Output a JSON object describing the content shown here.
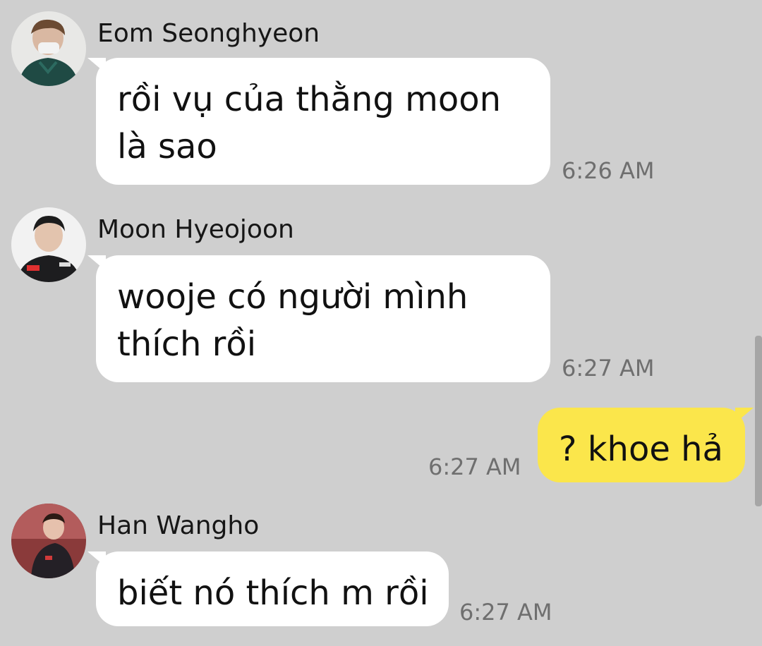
{
  "messages": [
    {
      "sender": "Eom Seonghyeon",
      "lines": [
        "rồi vụ của thằng moon",
        "là sao"
      ],
      "time": "6:26 AM",
      "avatar": "avatar-eom-seonghyeon"
    },
    {
      "sender": "Moon Hyeojoon",
      "lines": [
        "wooje có người mình",
        "thích rồi"
      ],
      "time": "6:27 AM",
      "avatar": "avatar-moon-hyeojoon"
    },
    {
      "sender": "",
      "lines": [
        "? khoe hả"
      ],
      "time": "6:27 AM",
      "outgoing": true
    },
    {
      "sender": "Han Wangho",
      "lines": [
        "biết nó thích m rồi"
      ],
      "time": "6:27 AM",
      "avatar": "avatar-han-wangho"
    }
  ],
  "colors": {
    "background": "#cfcfcf",
    "incoming_bubble": "#ffffff",
    "outgoing_bubble": "#fbe64b",
    "timestamp": "#6f6f6f"
  }
}
